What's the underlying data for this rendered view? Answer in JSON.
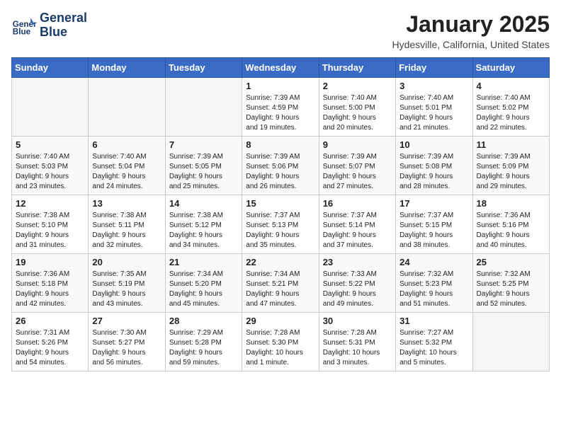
{
  "header": {
    "logo_line1": "General",
    "logo_line2": "Blue",
    "month": "January 2025",
    "location": "Hydesville, California, United States"
  },
  "days_of_week": [
    "Sunday",
    "Monday",
    "Tuesday",
    "Wednesday",
    "Thursday",
    "Friday",
    "Saturday"
  ],
  "weeks": [
    [
      {
        "day": "",
        "info": ""
      },
      {
        "day": "",
        "info": ""
      },
      {
        "day": "",
        "info": ""
      },
      {
        "day": "1",
        "info": "Sunrise: 7:39 AM\nSunset: 4:59 PM\nDaylight: 9 hours\nand 19 minutes."
      },
      {
        "day": "2",
        "info": "Sunrise: 7:40 AM\nSunset: 5:00 PM\nDaylight: 9 hours\nand 20 minutes."
      },
      {
        "day": "3",
        "info": "Sunrise: 7:40 AM\nSunset: 5:01 PM\nDaylight: 9 hours\nand 21 minutes."
      },
      {
        "day": "4",
        "info": "Sunrise: 7:40 AM\nSunset: 5:02 PM\nDaylight: 9 hours\nand 22 minutes."
      }
    ],
    [
      {
        "day": "5",
        "info": "Sunrise: 7:40 AM\nSunset: 5:03 PM\nDaylight: 9 hours\nand 23 minutes."
      },
      {
        "day": "6",
        "info": "Sunrise: 7:40 AM\nSunset: 5:04 PM\nDaylight: 9 hours\nand 24 minutes."
      },
      {
        "day": "7",
        "info": "Sunrise: 7:39 AM\nSunset: 5:05 PM\nDaylight: 9 hours\nand 25 minutes."
      },
      {
        "day": "8",
        "info": "Sunrise: 7:39 AM\nSunset: 5:06 PM\nDaylight: 9 hours\nand 26 minutes."
      },
      {
        "day": "9",
        "info": "Sunrise: 7:39 AM\nSunset: 5:07 PM\nDaylight: 9 hours\nand 27 minutes."
      },
      {
        "day": "10",
        "info": "Sunrise: 7:39 AM\nSunset: 5:08 PM\nDaylight: 9 hours\nand 28 minutes."
      },
      {
        "day": "11",
        "info": "Sunrise: 7:39 AM\nSunset: 5:09 PM\nDaylight: 9 hours\nand 29 minutes."
      }
    ],
    [
      {
        "day": "12",
        "info": "Sunrise: 7:38 AM\nSunset: 5:10 PM\nDaylight: 9 hours\nand 31 minutes."
      },
      {
        "day": "13",
        "info": "Sunrise: 7:38 AM\nSunset: 5:11 PM\nDaylight: 9 hours\nand 32 minutes."
      },
      {
        "day": "14",
        "info": "Sunrise: 7:38 AM\nSunset: 5:12 PM\nDaylight: 9 hours\nand 34 minutes."
      },
      {
        "day": "15",
        "info": "Sunrise: 7:37 AM\nSunset: 5:13 PM\nDaylight: 9 hours\nand 35 minutes."
      },
      {
        "day": "16",
        "info": "Sunrise: 7:37 AM\nSunset: 5:14 PM\nDaylight: 9 hours\nand 37 minutes."
      },
      {
        "day": "17",
        "info": "Sunrise: 7:37 AM\nSunset: 5:15 PM\nDaylight: 9 hours\nand 38 minutes."
      },
      {
        "day": "18",
        "info": "Sunrise: 7:36 AM\nSunset: 5:16 PM\nDaylight: 9 hours\nand 40 minutes."
      }
    ],
    [
      {
        "day": "19",
        "info": "Sunrise: 7:36 AM\nSunset: 5:18 PM\nDaylight: 9 hours\nand 42 minutes."
      },
      {
        "day": "20",
        "info": "Sunrise: 7:35 AM\nSunset: 5:19 PM\nDaylight: 9 hours\nand 43 minutes."
      },
      {
        "day": "21",
        "info": "Sunrise: 7:34 AM\nSunset: 5:20 PM\nDaylight: 9 hours\nand 45 minutes."
      },
      {
        "day": "22",
        "info": "Sunrise: 7:34 AM\nSunset: 5:21 PM\nDaylight: 9 hours\nand 47 minutes."
      },
      {
        "day": "23",
        "info": "Sunrise: 7:33 AM\nSunset: 5:22 PM\nDaylight: 9 hours\nand 49 minutes."
      },
      {
        "day": "24",
        "info": "Sunrise: 7:32 AM\nSunset: 5:23 PM\nDaylight: 9 hours\nand 51 minutes."
      },
      {
        "day": "25",
        "info": "Sunrise: 7:32 AM\nSunset: 5:25 PM\nDaylight: 9 hours\nand 52 minutes."
      }
    ],
    [
      {
        "day": "26",
        "info": "Sunrise: 7:31 AM\nSunset: 5:26 PM\nDaylight: 9 hours\nand 54 minutes."
      },
      {
        "day": "27",
        "info": "Sunrise: 7:30 AM\nSunset: 5:27 PM\nDaylight: 9 hours\nand 56 minutes."
      },
      {
        "day": "28",
        "info": "Sunrise: 7:29 AM\nSunset: 5:28 PM\nDaylight: 9 hours\nand 59 minutes."
      },
      {
        "day": "29",
        "info": "Sunrise: 7:28 AM\nSunset: 5:30 PM\nDaylight: 10 hours\nand 1 minute."
      },
      {
        "day": "30",
        "info": "Sunrise: 7:28 AM\nSunset: 5:31 PM\nDaylight: 10 hours\nand 3 minutes."
      },
      {
        "day": "31",
        "info": "Sunrise: 7:27 AM\nSunset: 5:32 PM\nDaylight: 10 hours\nand 5 minutes."
      },
      {
        "day": "",
        "info": ""
      }
    ]
  ]
}
